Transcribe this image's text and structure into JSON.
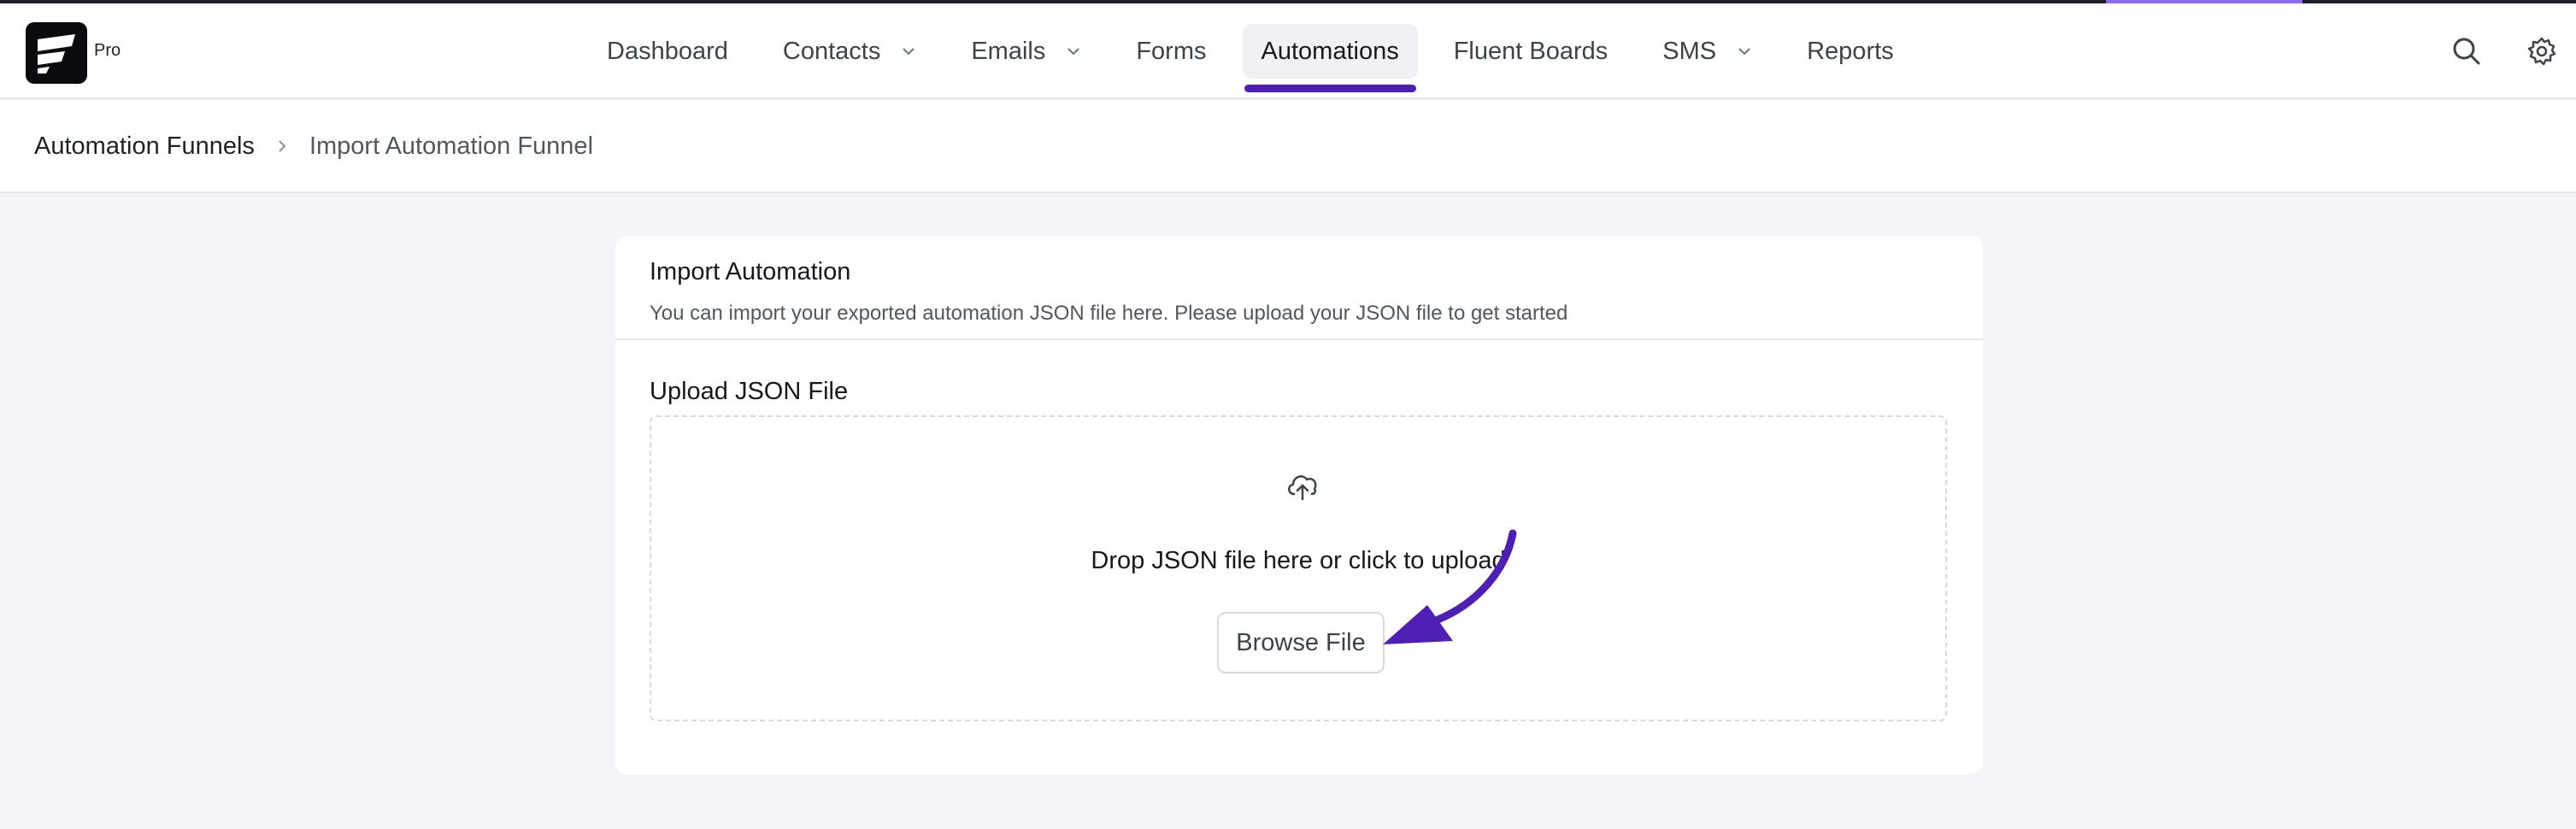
{
  "brand": {
    "badge": "Pro"
  },
  "nav": {
    "items": [
      {
        "label": "Dashboard"
      },
      {
        "label": "Contacts"
      },
      {
        "label": "Emails"
      },
      {
        "label": "Forms"
      },
      {
        "label": "Automations"
      },
      {
        "label": "Fluent Boards"
      },
      {
        "label": "SMS"
      },
      {
        "label": "Reports"
      }
    ],
    "active": "Automations"
  },
  "breadcrumb": {
    "parent": "Automation Funnels",
    "current": "Import Automation Funnel"
  },
  "card": {
    "title": "Import Automation",
    "description": "You can import your exported automation JSON file here. Please upload your JSON file to get started",
    "upload_label": "Upload JSON File",
    "drop_text": "Drop JSON file here or click to upload",
    "browse_label": "Browse File"
  },
  "colors": {
    "accent": "#4d1fb4",
    "progress": "#8b6cf0",
    "background": "#f4f5fb"
  }
}
